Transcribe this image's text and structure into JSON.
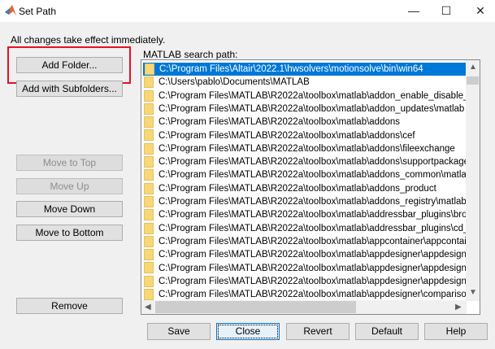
{
  "window": {
    "title": "Set Path",
    "minimize": "—",
    "maximize": "☐",
    "close": "✕"
  },
  "message": "All changes take effect immediately.",
  "left_buttons": {
    "add_folder": "Add Folder...",
    "add_subfolders": "Add with Subfolders...",
    "move_top": "Move to Top",
    "move_up": "Move Up",
    "move_down": "Move Down",
    "move_bottom": "Move to Bottom",
    "remove": "Remove"
  },
  "list": {
    "label": "MATLAB search path:",
    "items": [
      "C:\\Program Files\\Altair\\2022.1\\hwsolvers\\motionsolve\\bin\\win64",
      "C:\\Users\\pablo\\Documents\\MATLAB",
      "C:\\Program Files\\MATLAB\\R2022a\\toolbox\\matlab\\addon_enable_disable_mana",
      "C:\\Program Files\\MATLAB\\R2022a\\toolbox\\matlab\\addon_updates\\matlab",
      "C:\\Program Files\\MATLAB\\R2022a\\toolbox\\matlab\\addons",
      "C:\\Program Files\\MATLAB\\R2022a\\toolbox\\matlab\\addons\\cef",
      "C:\\Program Files\\MATLAB\\R2022a\\toolbox\\matlab\\addons\\fileexchange",
      "C:\\Program Files\\MATLAB\\R2022a\\toolbox\\matlab\\addons\\supportpackages",
      "C:\\Program Files\\MATLAB\\R2022a\\toolbox\\matlab\\addons_common\\matlab",
      "C:\\Program Files\\MATLAB\\R2022a\\toolbox\\matlab\\addons_product",
      "C:\\Program Files\\MATLAB\\R2022a\\toolbox\\matlab\\addons_registry\\matlab",
      "C:\\Program Files\\MATLAB\\R2022a\\toolbox\\matlab\\addressbar_plugins\\browse_f",
      "C:\\Program Files\\MATLAB\\R2022a\\toolbox\\matlab\\addressbar_plugins\\cd_up_o",
      "C:\\Program Files\\MATLAB\\R2022a\\toolbox\\matlab\\appcontainer\\appcontainer",
      "C:\\Program Files\\MATLAB\\R2022a\\toolbox\\matlab\\appdesigner\\appdesigner",
      "C:\\Program Files\\MATLAB\\R2022a\\toolbox\\matlab\\appdesigner\\appdesigner\\in",
      "C:\\Program Files\\MATLAB\\R2022a\\toolbox\\matlab\\appdesigner\\appdesigner\\ru",
      "C:\\Program Files\\MATLAB\\R2022a\\toolbox\\matlab\\appdesigner\\comparisons\\m"
    ],
    "selected_index": 0
  },
  "bottom_buttons": {
    "save": "Save",
    "close": "Close",
    "revert": "Revert",
    "default": "Default",
    "help": "Help"
  },
  "colors": {
    "selection": "#0078d7",
    "highlight_box": "#e81123"
  }
}
